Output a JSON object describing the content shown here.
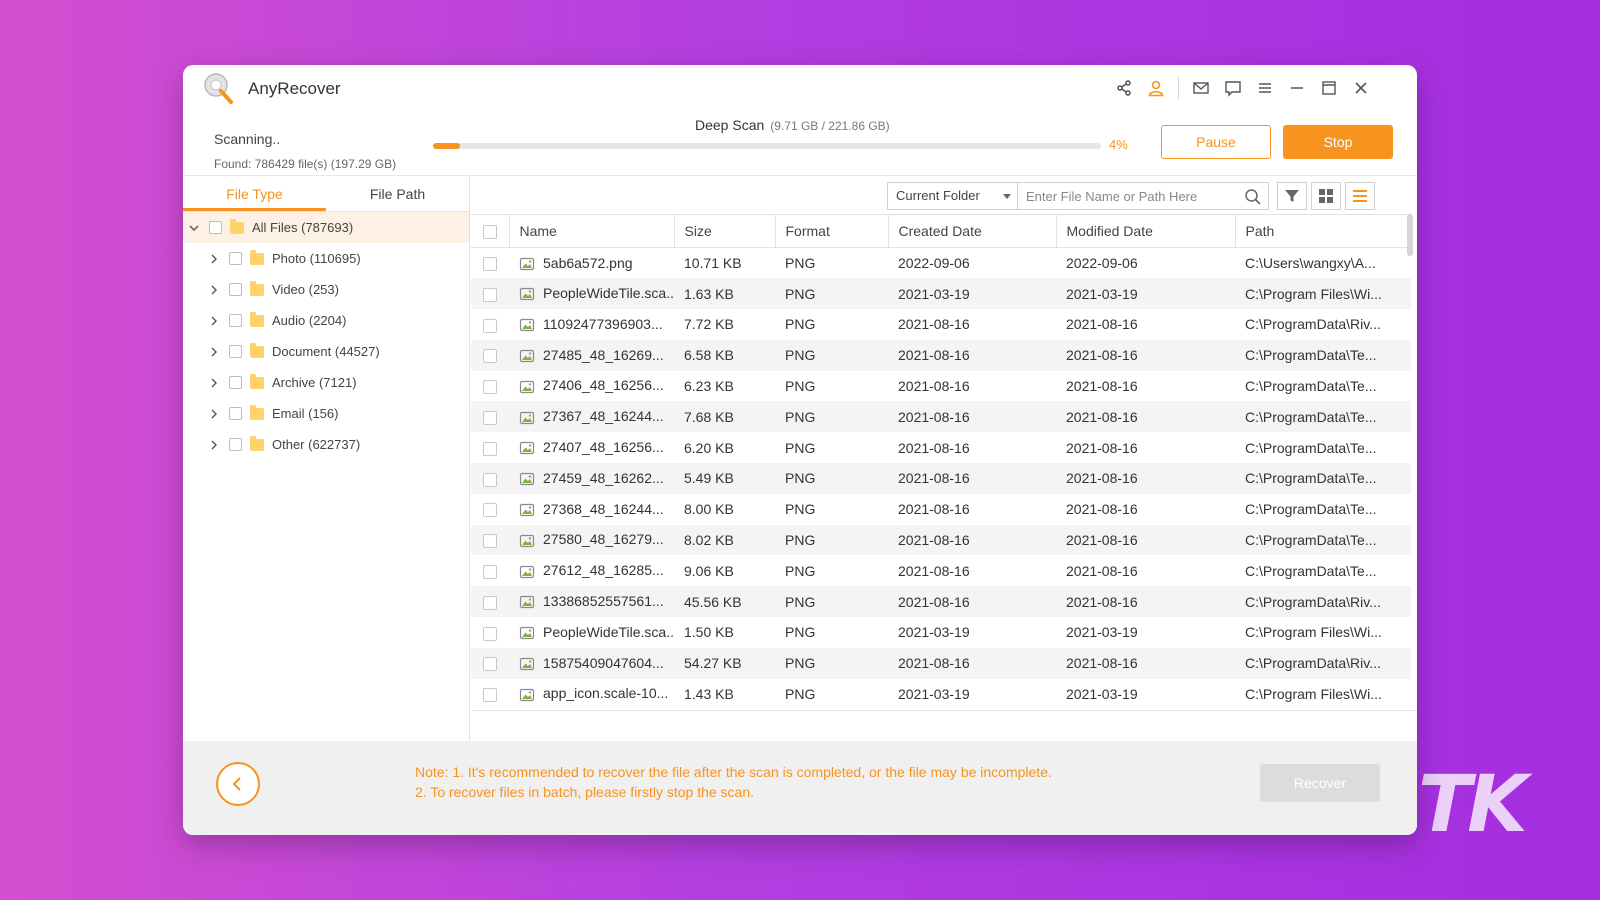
{
  "app": {
    "title": "AnyRecover"
  },
  "scan": {
    "status": "Scanning..",
    "found": "Found: 786429 file(s) (197.29 GB)",
    "mode": "Deep Scan",
    "detail": "(9.71 GB / 221.86 GB)",
    "progress_percent": 4,
    "progress_label": "4%",
    "pause_label": "Pause",
    "stop_label": "Stop"
  },
  "tabs": [
    {
      "label": "File Type",
      "active": true
    },
    {
      "label": "File Path",
      "active": false
    }
  ],
  "tree": [
    {
      "label": "All Files (787693)",
      "root": true
    },
    {
      "label": "Photo (110695)"
    },
    {
      "label": "Video (253)"
    },
    {
      "label": "Audio (2204)"
    },
    {
      "label": "Document (44527)"
    },
    {
      "label": "Archive (7121)"
    },
    {
      "label": "Email (156)"
    },
    {
      "label": "Other (622737)"
    }
  ],
  "toolbar": {
    "scope": "Current Folder",
    "search_placeholder": "Enter File Name or Path Here"
  },
  "table": {
    "columns": [
      "Name",
      "Size",
      "Format",
      "Created Date",
      "Modified Date",
      "Path"
    ],
    "rows": [
      [
        "5ab6a572.png",
        "10.71 KB",
        "PNG",
        "2022-09-06",
        "2022-09-06",
        "C:\\Users\\wangxy\\A..."
      ],
      [
        "PeopleWideTile.sca...",
        "1.63 KB",
        "PNG",
        "2021-03-19",
        "2021-03-19",
        "C:\\Program Files\\Wi..."
      ],
      [
        "11092477396903...",
        "7.72 KB",
        "PNG",
        "2021-08-16",
        "2021-08-16",
        "C:\\ProgramData\\Riv..."
      ],
      [
        "27485_48_16269...",
        "6.58 KB",
        "PNG",
        "2021-08-16",
        "2021-08-16",
        "C:\\ProgramData\\Te..."
      ],
      [
        "27406_48_16256...",
        "6.23 KB",
        "PNG",
        "2021-08-16",
        "2021-08-16",
        "C:\\ProgramData\\Te..."
      ],
      [
        "27367_48_16244...",
        "7.68 KB",
        "PNG",
        "2021-08-16",
        "2021-08-16",
        "C:\\ProgramData\\Te..."
      ],
      [
        "27407_48_16256...",
        "6.20 KB",
        "PNG",
        "2021-08-16",
        "2021-08-16",
        "C:\\ProgramData\\Te..."
      ],
      [
        "27459_48_16262...",
        "5.49 KB",
        "PNG",
        "2021-08-16",
        "2021-08-16",
        "C:\\ProgramData\\Te..."
      ],
      [
        "27368_48_16244...",
        "8.00 KB",
        "PNG",
        "2021-08-16",
        "2021-08-16",
        "C:\\ProgramData\\Te..."
      ],
      [
        "27580_48_16279...",
        "8.02 KB",
        "PNG",
        "2021-08-16",
        "2021-08-16",
        "C:\\ProgramData\\Te..."
      ],
      [
        "27612_48_16285...",
        "9.06 KB",
        "PNG",
        "2021-08-16",
        "2021-08-16",
        "C:\\ProgramData\\Te..."
      ],
      [
        "13386852557561...",
        "45.56 KB",
        "PNG",
        "2021-08-16",
        "2021-08-16",
        "C:\\ProgramData\\Riv..."
      ],
      [
        "PeopleWideTile.sca...",
        "1.50 KB",
        "PNG",
        "2021-03-19",
        "2021-03-19",
        "C:\\Program Files\\Wi..."
      ],
      [
        "15875409047604...",
        "54.27 KB",
        "PNG",
        "2021-08-16",
        "2021-08-16",
        "C:\\ProgramData\\Riv..."
      ],
      [
        "app_icon.scale-10...",
        "1.43 KB",
        "PNG",
        "2021-03-19",
        "2021-03-19",
        "C:\\Program Files\\Wi..."
      ]
    ]
  },
  "footer": {
    "note_line1": "Note: 1. It's recommended to recover the file after the scan is completed, or the file may be incomplete.",
    "note_line2": "2. To recover files in batch, please firstly stop the scan.",
    "recover_label": "Recover"
  },
  "colors": {
    "accent": "#f7931e",
    "background_start": "#d44fd0",
    "background_end": "#a42ee0"
  },
  "watermark": "TK"
}
